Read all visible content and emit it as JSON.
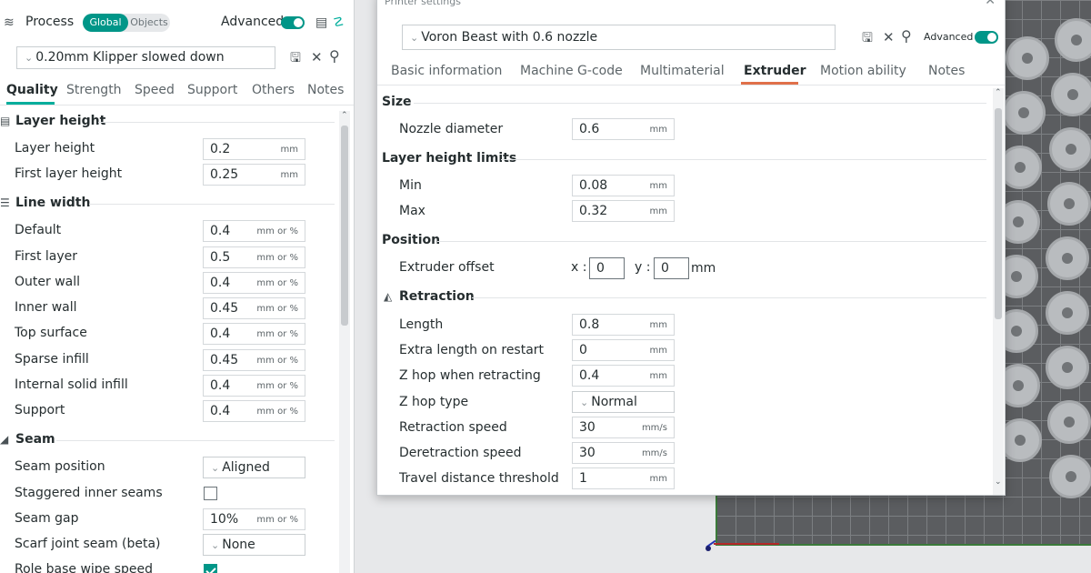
{
  "process": {
    "title": "Process",
    "global_label": "Global",
    "objects_label": "Objects",
    "advanced_label": "Advanced",
    "preset": "0.20mm Klipper slowed down",
    "tabs": [
      "Quality",
      "Strength",
      "Speed",
      "Support",
      "Others",
      "Notes"
    ],
    "active_tab": "Quality",
    "sections": {
      "layer_height": "Layer height",
      "line_width": "Line width",
      "seam": "Seam"
    },
    "layer_height_rows": [
      {
        "label": "Layer height",
        "value": "0.2",
        "unit": "mm"
      },
      {
        "label": "First layer height",
        "value": "0.25",
        "unit": "mm"
      }
    ],
    "line_width_rows": [
      {
        "label": "Default",
        "value": "0.4",
        "unit": "mm or %"
      },
      {
        "label": "First layer",
        "value": "0.5",
        "unit": "mm or %"
      },
      {
        "label": "Outer wall",
        "value": "0.4",
        "unit": "mm or %"
      },
      {
        "label": "Inner wall",
        "value": "0.45",
        "unit": "mm or %"
      },
      {
        "label": "Top surface",
        "value": "0.4",
        "unit": "mm or %"
      },
      {
        "label": "Sparse infill",
        "value": "0.45",
        "unit": "mm or %"
      },
      {
        "label": "Internal solid infill",
        "value": "0.4",
        "unit": "mm or %"
      },
      {
        "label": "Support",
        "value": "0.4",
        "unit": "mm or %"
      }
    ],
    "seam_rows": {
      "seam_position": {
        "label": "Seam position",
        "value": "Aligned"
      },
      "staggered": {
        "label": "Staggered inner seams",
        "checked": false
      },
      "seam_gap": {
        "label": "Seam gap",
        "value": "10%",
        "unit": "mm or %"
      },
      "scarf": {
        "label": "Scarf joint seam (beta)",
        "value": "None"
      },
      "role_wipe": {
        "label": "Role base wipe speed",
        "checked": true
      }
    }
  },
  "printer_dialog": {
    "title": "Printer settings",
    "preset": "Voron Beast with 0.6 nozzle",
    "advanced_label": "Advanced",
    "tabs": [
      "Basic information",
      "Machine G-code",
      "Multimaterial",
      "Extruder",
      "Motion ability",
      "Notes"
    ],
    "active_tab": "Extruder",
    "sections": {
      "size": "Size",
      "limits": "Layer height limits",
      "position": "Position",
      "retraction": "Retraction"
    },
    "nozzle": {
      "label": "Nozzle diameter",
      "value": "0.6",
      "unit": "mm"
    },
    "min": {
      "label": "Min",
      "value": "0.08",
      "unit": "mm"
    },
    "max": {
      "label": "Max",
      "value": "0.32",
      "unit": "mm"
    },
    "offset": {
      "label": "Extruder offset",
      "x_label": "x :",
      "x_value": "0",
      "y_label": "y :",
      "y_value": "0",
      "unit": "mm"
    },
    "retraction_rows": [
      {
        "label": "Length",
        "value": "0.8",
        "unit": "mm"
      },
      {
        "label": "Extra length on restart",
        "value": "0",
        "unit": "mm"
      },
      {
        "label": "Z hop when retracting",
        "value": "0.4",
        "unit": "mm"
      },
      {
        "label": "Z hop type",
        "value": "Normal",
        "unit": ""
      },
      {
        "label": "Retraction speed",
        "value": "30",
        "unit": "mm/s"
      },
      {
        "label": "Deretraction speed",
        "value": "30",
        "unit": "mm/s"
      },
      {
        "label": "Travel distance threshold",
        "value": "1",
        "unit": "mm"
      }
    ]
  },
  "colors": {
    "accent": "#009688",
    "tab_underline": "#e0704a"
  }
}
